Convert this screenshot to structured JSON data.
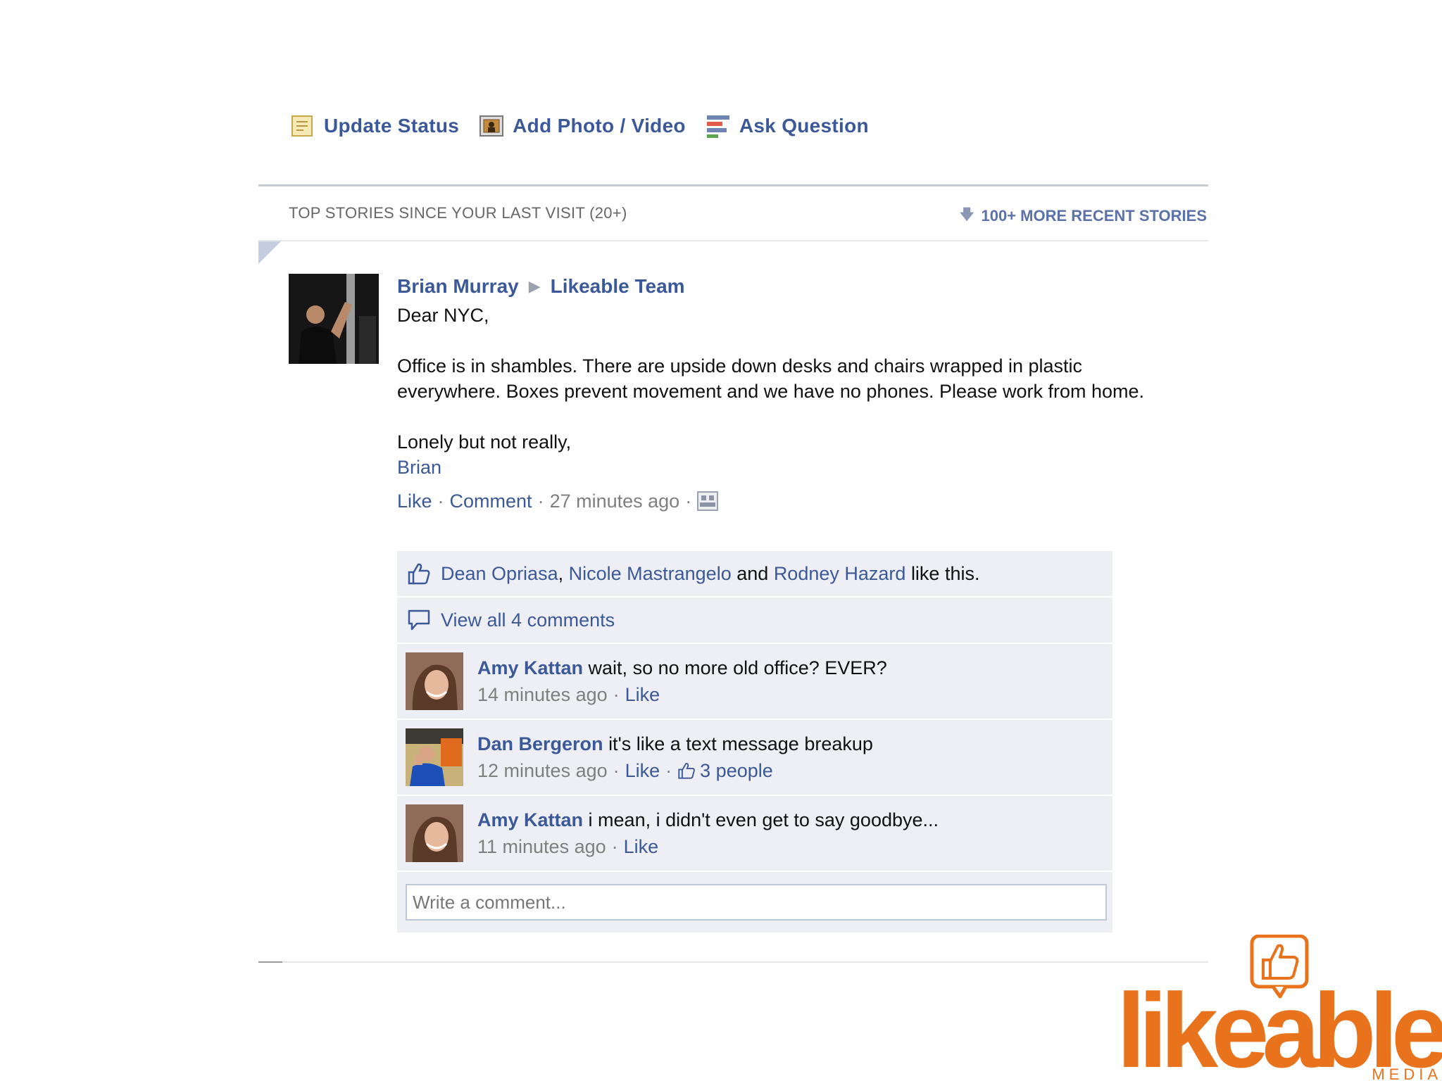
{
  "composer": {
    "update_status": "Update Status",
    "add_photo": "Add Photo / Video",
    "ask_question": "Ask Question"
  },
  "stories_bar": {
    "top_stories": "TOP STORIES SINCE YOUR LAST VISIT (20+)",
    "recent_stories": "100+ MORE RECENT STORIES"
  },
  "post": {
    "author": "Brian Murray",
    "target": "Likeable Team",
    "body": "Dear NYC,\n\nOffice is in shambles. There are upside down desks and chairs wrapped in plastic everywhere. Boxes prevent movement and we have no phones. Please work from home.\n\nLonely but not really,",
    "signature": "Brian",
    "like_label": "Like",
    "comment_label": "Comment",
    "timestamp": "27 minutes ago"
  },
  "likes": {
    "person1": "Dean Opriasa",
    "person2": "Nicole Mastrangelo",
    "and_text": "and",
    "person3": "Rodney Hazard",
    "suffix": "like this."
  },
  "view_all": "View all 4 comments",
  "comments": [
    {
      "author": "Amy Kattan",
      "text": "wait, so no more old office? EVER?",
      "time": "14 minutes ago",
      "like_label": "Like"
    },
    {
      "author": "Dan Bergeron",
      "text": "it's like a text message breakup",
      "time": "12 minutes ago",
      "like_label": "Like",
      "likes_count": "3 people"
    },
    {
      "author": "Amy Kattan",
      "text": "i mean, i didn't even get to say goodbye...",
      "time": "11 minutes ago",
      "like_label": "Like"
    }
  ],
  "comment_input": {
    "placeholder": "Write a comment..."
  },
  "logo": {
    "word": "likeable",
    "sub": "MEDIA"
  },
  "colors": {
    "link": "#3b5998",
    "feedback_bg": "#edeff4",
    "logo_orange": "#e8731c"
  }
}
